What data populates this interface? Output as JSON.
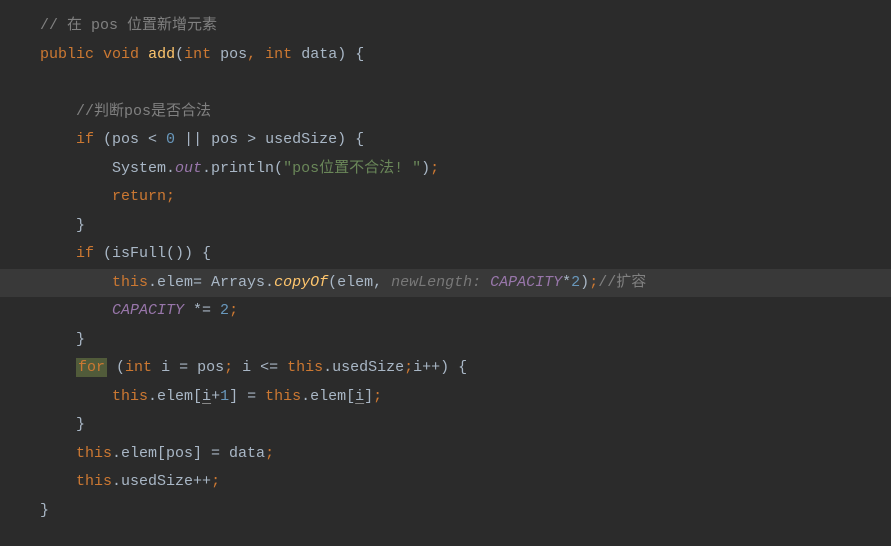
{
  "code": {
    "line1_comment": "// 在 pos 位置新增元素",
    "line2_public": "public",
    "line2_void": "void",
    "line2_method": "add",
    "line2_int1": "int",
    "line2_param1": "pos",
    "line2_int2": "int",
    "line2_param2": "data",
    "line2_brace": ") {",
    "line4_comment": "//判断pos是否合法",
    "line5_if": "if",
    "line5_cond_open": " (pos < ",
    "line5_zero": "0",
    "line5_or": " || pos > usedSize) {",
    "line6_system": "System.",
    "line6_out": "out",
    "line6_println": ".println(",
    "line6_string": "\"pos位置不合法! \"",
    "line6_close": ")",
    "line6_semi": ";",
    "line7_return": "return",
    "line7_semi": ";",
    "line8_brace": "}",
    "line9_if": "if",
    "line9_cond": " (isFull()) {",
    "line10_this": "this",
    "line10_elem": ".elem= Arrays.",
    "line10_copyof": "copyOf",
    "line10_open": "(elem, ",
    "line10_hint": "newLength: ",
    "line10_capacity": "CAPACITY",
    "line10_mult": "*",
    "line10_two": "2",
    "line10_close": ")",
    "line10_semi": ";",
    "line10_comment": "//扩容",
    "line11_capacity": "CAPACITY",
    "line11_assign": " *= ",
    "line11_two": "2",
    "line11_semi": ";",
    "line12_brace": "}",
    "line13_for": "for",
    "line13_open": " (",
    "line13_int": "int",
    "line13_init": " i = pos",
    "line13_semi1": ";",
    "line13_cond": " i <= ",
    "line13_this": "this",
    "line13_used": ".usedSize",
    "line13_semi2": ";",
    "line13_inc": "i++) {",
    "line14_this1": "this",
    "line14_elem1": ".elem[",
    "line14_i1": "i",
    "line14_plus1": "+",
    "line14_one": "1",
    "line14_close1": "] = ",
    "line14_this2": "this",
    "line14_elem2": ".elem[",
    "line14_i2": "i",
    "line14_close2": "]",
    "line14_semi": ";",
    "line15_brace": "}",
    "line16_this": "this",
    "line16_elem": ".elem[pos] = data",
    "line16_semi": ";",
    "line17_this": "this",
    "line17_used": ".usedSize++",
    "line17_semi": ";",
    "line18_brace": "}"
  }
}
